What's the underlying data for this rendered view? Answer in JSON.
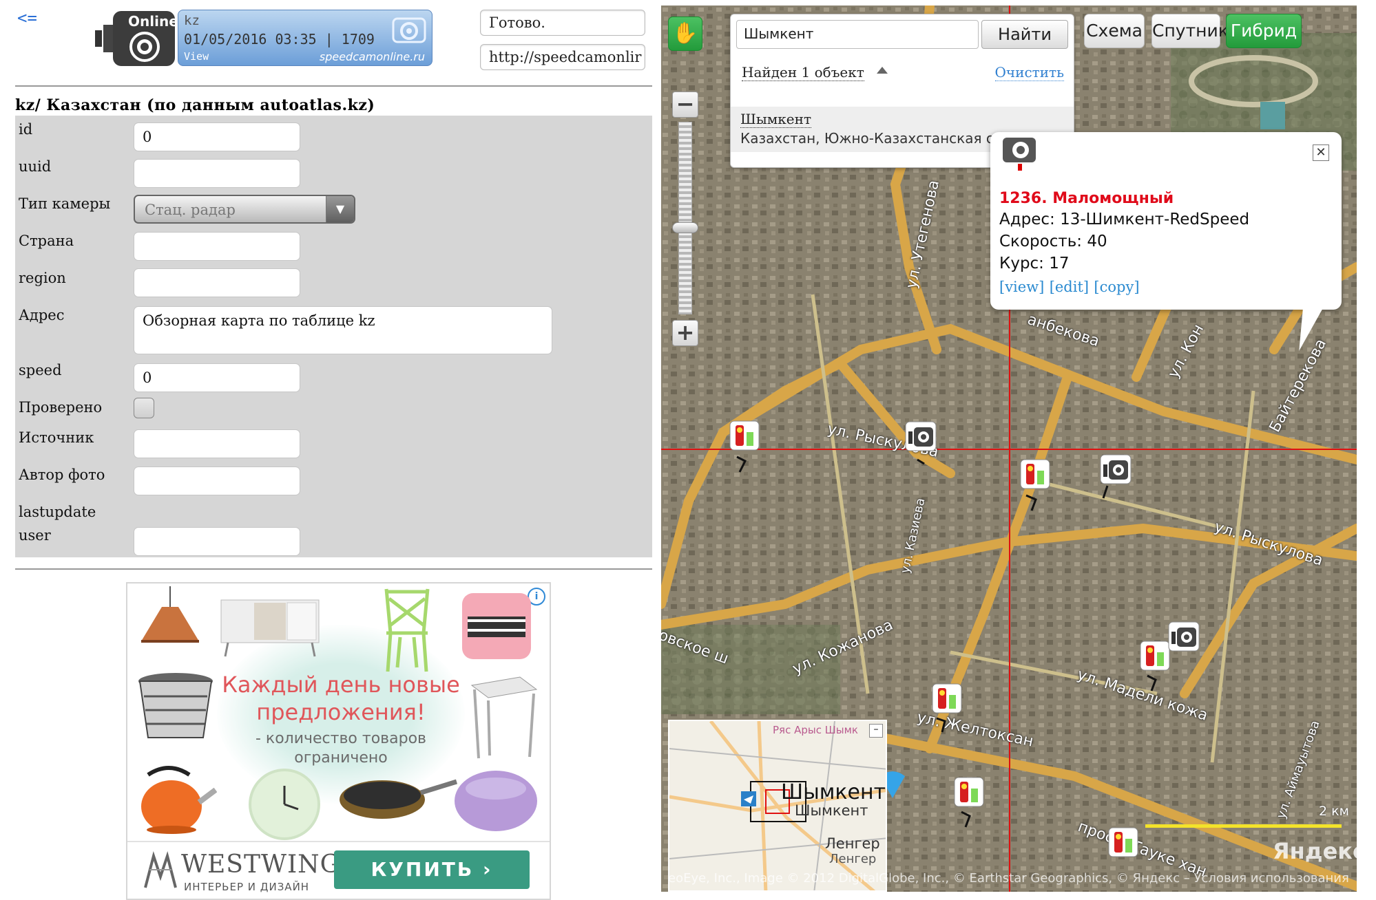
{
  "left": {
    "back_link": "<=",
    "widget": {
      "brand": "Online",
      "country": "kz",
      "datetime": "01/05/2016 03:35 | 1709",
      "view": "View",
      "site": "speedcamonline.ru"
    },
    "status": "Готово.",
    "url": "http://speedcamonlir",
    "section_title": "kz/ Казахстан (по данным autoatlas.kz)",
    "fields": {
      "id": {
        "label": "id",
        "value": "0"
      },
      "uuid": {
        "label": "uuid",
        "value": ""
      },
      "camera_type": {
        "label": "Тип камеры",
        "value": "Стац. радар"
      },
      "country": {
        "label": "Страна",
        "value": ""
      },
      "region": {
        "label": "region",
        "value": ""
      },
      "address": {
        "label": "Адрес",
        "value": "Обзорная карта по таблице kz"
      },
      "speed": {
        "label": "speed",
        "value": "0"
      },
      "verified": {
        "label": "Проверено"
      },
      "source": {
        "label": "Источник",
        "value": ""
      },
      "photo_author": {
        "label": "Автор фото",
        "value": ""
      },
      "lastupdate": {
        "label": "lastupdate"
      },
      "user": {
        "label": "user",
        "value": ""
      }
    },
    "ad": {
      "headline_1": "Каждый день новые",
      "headline_2": "предложения!",
      "sub_1": "- количество товаров",
      "sub_2": "ограничено",
      "brand": "WESTWING",
      "brand_sub": "ИНТЕРЬЕР И ДИЗАЙН",
      "buy": "КУПИТЬ ›",
      "info": "i"
    }
  },
  "map": {
    "search_value": "Шымкент",
    "search_button": "Найти",
    "found": "Найден 1 объект",
    "clear": "Очистить",
    "result_name": "Шымкент",
    "result_desc": "Казахстан, Южно-Казахстанская область",
    "view_buttons": {
      "scheme": "Схема",
      "satellite": "Спутник",
      "hybrid": "Гибрид"
    },
    "active_view": "Гибрид",
    "zoom_minus": "−",
    "zoom_plus": "+",
    "popup": {
      "close": "✕",
      "title": "1236. Маломощный",
      "address": "Адрес: 13-Шимкент-RedSpeed",
      "speed": "Скорость: 40",
      "course": "Курс: 17",
      "view_link": "[view]",
      "edit_link": "[edit]",
      "copy_link": "[copy]"
    },
    "streets": {
      "ryskulova_1": "ул. Рыскулова",
      "ryskulova_2": "ул. Рыскулова",
      "utegenova": "ул. Утегенова",
      "kazieva": "ул. Казиева",
      "kozhanova": "ул. Кожанова",
      "madeli_kozha": "ул. Мадели кожа",
      "zheltoksan": "ул. Желтоксан",
      "tauke": "просп. Тауке хан",
      "aimautova": "ул. Аймауытова",
      "bekova": "анбекова",
      "baiterkova": "Байтерекова",
      "kon": "ул. Кон",
      "ovskoe": "овское ш"
    },
    "minimap": {
      "city": "Шымкент",
      "city_small": "Шымкент",
      "town": "Ленгер",
      "town_small": "Ленгер",
      "road": "Ряс Арыс Шымк"
    },
    "scale_label": "2 км",
    "copyright": "eoEye, Inc., Image © 2012 DigitalGlobe, Inc., © Earthstar Geographics, © Яндекс – Условия использования",
    "yandex": "Яндекс",
    "colors": {
      "active_green": "#2fab48",
      "popup_title": "#e00a1a",
      "crosshair": "#e01010",
      "road": "#d8a648"
    }
  }
}
